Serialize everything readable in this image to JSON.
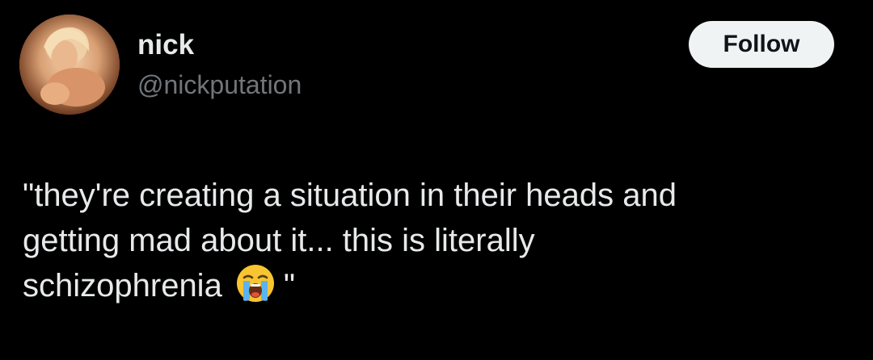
{
  "user": {
    "display_name": "nick",
    "handle": "@nickputation",
    "avatar_icon": "profile-photo"
  },
  "follow_button": {
    "label": "Follow"
  },
  "tweet": {
    "lines": [
      "\"they're creating a situation in their heads and",
      "getting mad about it... this is literally",
      "schizophrenia"
    ],
    "closing_quote": "\"",
    "emoji_icon": "loudly-crying-face-icon"
  },
  "colors": {
    "background": "#000000",
    "primary_text": "#e7e9ea",
    "secondary_text": "#71767b",
    "button_bg": "#eff3f4",
    "button_text": "#0f1419"
  }
}
